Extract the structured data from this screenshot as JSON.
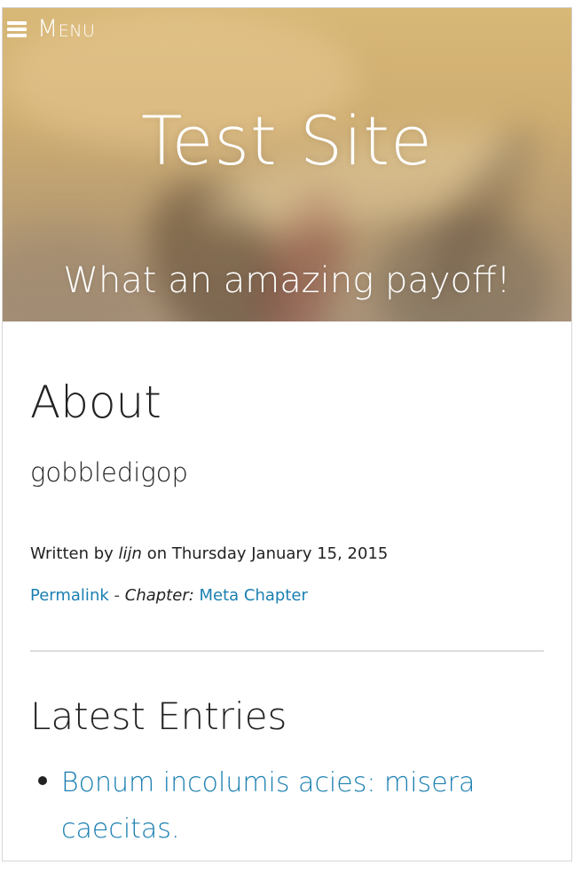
{
  "header": {
    "menu_label": "Menu",
    "site_title": "Test Site",
    "tagline": "What an amazing payoff!"
  },
  "page": {
    "title": "About",
    "body": "gobbledigop",
    "byline": {
      "prefix": "Written by",
      "author": "lijn",
      "date_text": "on Thursday January 15, 2015"
    },
    "meta": {
      "permalink_label": "Permalink",
      "separator": "-",
      "chapter_prefix": "Chapter:",
      "chapter_name": "Meta Chapter"
    }
  },
  "latest_entries": {
    "title": "Latest Entries",
    "items": [
      {
        "label": "Bonum incolumis acies: misera caecitas."
      }
    ]
  },
  "colors": {
    "link": "#1a7fb1",
    "text": "#222222",
    "divider": "#dddddd"
  }
}
